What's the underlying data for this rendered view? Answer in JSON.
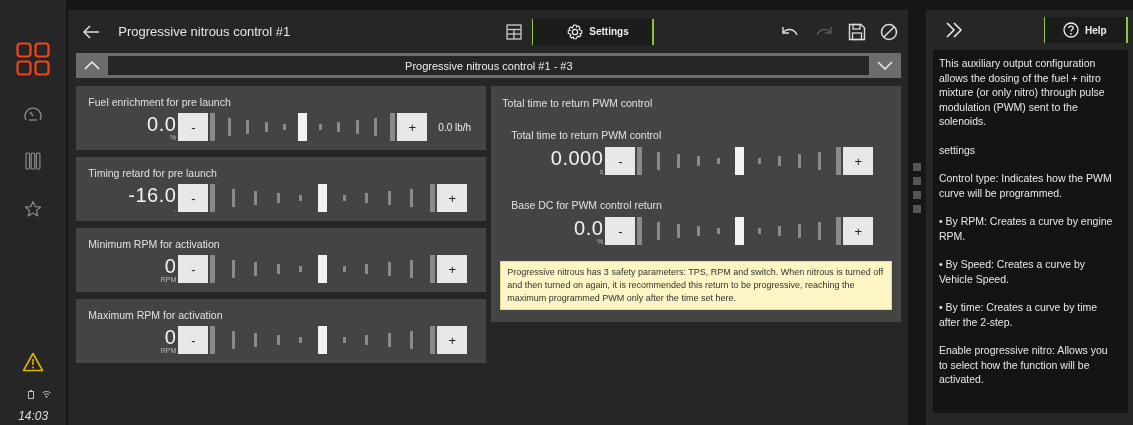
{
  "sidebar": {
    "items": [
      {
        "kind": "modules",
        "selected": true
      },
      {
        "kind": "gauge",
        "selected": false
      },
      {
        "kind": "bars",
        "selected": false
      },
      {
        "kind": "favorites",
        "selected": false
      }
    ],
    "alert": true,
    "time": "14:03"
  },
  "header": {
    "title": "Progressive nitrous control #1",
    "tabs": [
      {
        "kind": "table",
        "selected": false
      },
      {
        "kind": "settings",
        "label": "Settings",
        "selected": true
      }
    ],
    "tools": [
      {
        "kind": "undo",
        "disabled": false
      },
      {
        "kind": "redo",
        "disabled": true
      },
      {
        "kind": "save",
        "disabled": false
      },
      {
        "kind": "cancel",
        "disabled": false
      }
    ]
  },
  "selector": {
    "label": "Progressive nitrous control #1 - #3"
  },
  "left_cards": [
    {
      "title": "Fuel enrichment for pre launch",
      "value": "0.0",
      "unit": "%",
      "minus": "-",
      "plus": "+",
      "readout": "0.0 lb/h"
    },
    {
      "title": "Timing retard for pre launch",
      "value": "-16.0",
      "unit": ".",
      "minus": "-",
      "plus": "+"
    },
    {
      "title": "Minimum RPM for activation",
      "value": "0",
      "unit": "RPM",
      "minus": "-",
      "plus": "+"
    },
    {
      "title": "Maximum RPM for activation",
      "value": "0",
      "unit": "RPM",
      "minus": "-",
      "plus": "+"
    }
  ],
  "right_card": {
    "title": "Total time to return PWM control",
    "fields": [
      {
        "title": "Total time to return PWM control",
        "value": "0.000",
        "unit": "s",
        "minus": "-",
        "plus": "+"
      },
      {
        "title": "Base DC for PWM control return",
        "value": "0.0",
        "unit": "%",
        "minus": "-",
        "plus": "+"
      }
    ],
    "note": "Progressive nitrous has 3 safety parameters: TPS, RPM and switch. When nitrous is turned off and then turned on again, it is recommended this return to be progressive, reaching the maximum programmed PWM only after the time set here."
  },
  "help": {
    "tab": {
      "label": "Help",
      "selected": true
    },
    "paragraphs": [
      "This auxiliary output configuration allows the dosing of the fuel + nitro mixture (or only nitro) through pulse modulation (PWM) sent to the solenoids.",
      "settings",
      "Control type: Indicates how the PWM curve will be programmed.",
      "• By RPM: Creates a curve by engine RPM.",
      "• By Speed: Creates a curve by Vehicle Speed.",
      "• By time: Creates a curve by time after the 2-step.",
      "Enable progressive nitro: Allows you to select how the function will be activated."
    ]
  }
}
